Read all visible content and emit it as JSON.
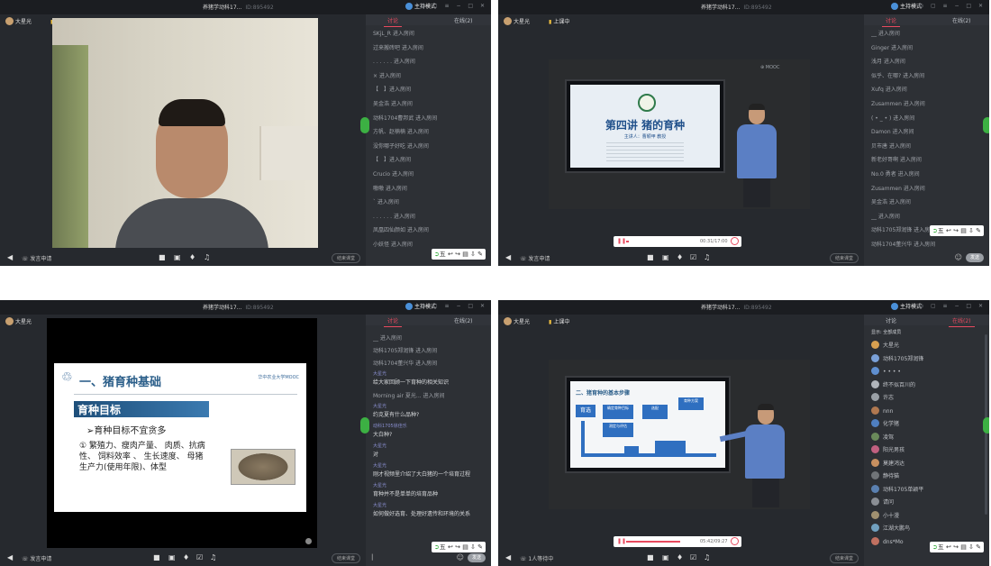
{
  "title": "养猪学动科17...",
  "room_id": "ID:895492",
  "host_mode": "主持模式",
  "user": "大星光",
  "class_status": "上课中",
  "mic_btn": "发言申请",
  "mic_btn_4": "1人等待中",
  "end_btn": "结束课堂",
  "send_btn": "发送",
  "tab_discuss": "讨论",
  "tab_online": "在线(2)",
  "accent": "#e84a5f",
  "toolbar_text": "五",
  "player2": {
    "time": "00:31/17:00"
  },
  "player4": {
    "time": "05:42/09:27"
  },
  "win1_msgs": [
    "SKjL_R 进入房间",
    "过来搬砖吧 进入房间",
    ". . . . . . 进入房间",
    "× 进入房间",
    "【　】进入房间",
    "吴金浩 进入房间",
    "动科1704曹邦武 进入房间",
    "方帆、赵楠楠 进入房间",
    "没你哪子好吃 进入房间",
    "【　】进入房间",
    "Crucio 进入房间",
    "嗷嗷 进入房间",
    "` 进入房间",
    ". . . . . . 进入房间",
    "凤凰四仙颜如 进入房间",
    "小妖怪 进入房间"
  ],
  "win2_msgs": [
    "__ 进入房间",
    "Ginger 进入房间",
    "浅月 进入房间",
    "似乎、在哪? 进入房间",
    "Xufq 进入房间",
    "Zusammen 进入房间",
    "( • _ • ) 进入房间",
    "Damon 进入房间",
    "贝市唐 进入房间",
    "新老好哥啊 进入房间",
    "No.0 勇者 进入房间",
    "Zusammen 进入房间",
    "吴金浩 进入房间",
    "__ 进入房间",
    "动科1705郑润锋 进入房间",
    "动科1704董兴华 进入房间"
  ],
  "win3_sys_top": [
    "__ 进入房间",
    "动科1705郑润锋 进入房间",
    "动科1704董兴华 进入房间"
  ],
  "win3_chat": [
    {
      "who": "大星光",
      "txt": "给大家回顾一下育种的相关知识"
    },
    {
      "sys": "Morning air 夏光... 进入房间"
    },
    {
      "who": "大星光",
      "txt": "约克夏有什么品种?"
    },
    {
      "who": "动科1705徐佳乐",
      "txt": "大白种?"
    },
    {
      "who": "大星光",
      "txt": "对"
    },
    {
      "who": "大星光",
      "txt": "刚才视频里介绍了大白猪的一个培育过程"
    },
    {
      "who": "大星光",
      "txt": "育种并不是单单的培育品种"
    },
    {
      "who": "大星光",
      "txt": "如何做好选育、处理好遗传和环境的关系"
    }
  ],
  "win4_filter": "显示: 全部成员",
  "win4_members": [
    {
      "name": "大星光",
      "c": "#d8a050"
    },
    {
      "name": "动科1705郑润锋",
      "c": "#7aa0d8"
    },
    {
      "name": "• • • •",
      "c": "#5f8fd0"
    },
    {
      "name": "终不似百川的",
      "c": "#b0b4ba"
    },
    {
      "name": "许志",
      "c": "#9aa0a6"
    },
    {
      "name": "nnn",
      "c": "#b07850"
    },
    {
      "name": "化学猪",
      "c": "#4f7fc0"
    },
    {
      "name": "凌驾",
      "c": "#6a8a5a"
    },
    {
      "name": "阳光男孩",
      "c": "#c06080"
    },
    {
      "name": "莫建鸿达",
      "c": "#c89060"
    },
    {
      "name": "静待猫",
      "c": "#707478"
    },
    {
      "name": "动科1705单颖平",
      "c": "#5a80b0"
    },
    {
      "name": "请问",
      "c": "#8a8e94"
    },
    {
      "name": "小十漫",
      "c": "#a09070"
    },
    {
      "name": "江湖大鹏鸟",
      "c": "#70a0c0"
    },
    {
      "name": "dns*Mo",
      "c": "#c07060"
    }
  ],
  "slide2": {
    "title": "第四讲  猪的育种",
    "speaker": "主讲人：曹颖甲  教授"
  },
  "slide3": {
    "heading": "一、猪育种基础",
    "logo": "华中农业大学MOOC",
    "band": "育种目标",
    "line1": "➢育种目标不宜贪多",
    "line2": "① 繁殖力、瘦肉产量、 肉质、抗病性、 饲料效率 、 生长速度、 母猪生产力(使用年限)、体型"
  },
  "slide4": {
    "heading": "二、猪育种的基本步骤",
    "boxes": [
      "育选",
      "确定育种目标",
      "测定与评估",
      "选配",
      "育种方案"
    ]
  }
}
